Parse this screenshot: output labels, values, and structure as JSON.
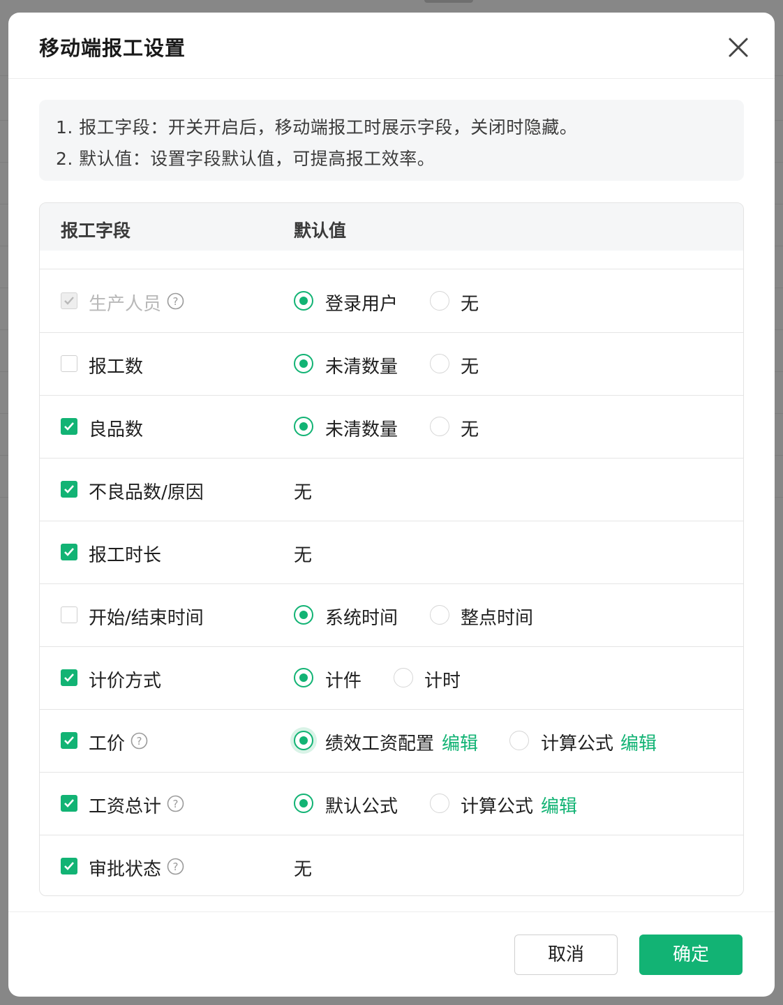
{
  "modal": {
    "title": "移动端报工设置",
    "info_lines": [
      "1. 报工字段：开关开启后，移动端报工时展示字段，关闭时隐藏。",
      "2. 默认值：设置字段默认值，可提高报工效率。"
    ],
    "table": {
      "headers": {
        "field": "报工字段",
        "default": "默认值"
      },
      "rows": [
        {
          "field": "生产人员",
          "checked": true,
          "disabled": true,
          "help": true,
          "options": [
            {
              "label": "登录用户",
              "selected": true
            },
            {
              "label": "无",
              "selected": false
            }
          ]
        },
        {
          "field": "报工数",
          "checked": false,
          "disabled": false,
          "help": false,
          "options": [
            {
              "label": "未清数量",
              "selected": true
            },
            {
              "label": "无",
              "selected": false
            }
          ]
        },
        {
          "field": "良品数",
          "checked": true,
          "disabled": false,
          "help": false,
          "options": [
            {
              "label": "未清数量",
              "selected": true
            },
            {
              "label": "无",
              "selected": false
            }
          ]
        },
        {
          "field": "不良品数/原因",
          "checked": true,
          "disabled": false,
          "help": false,
          "plain": "无"
        },
        {
          "field": "报工时长",
          "checked": true,
          "disabled": false,
          "help": false,
          "plain": "无"
        },
        {
          "field": "开始/结束时间",
          "checked": false,
          "disabled": false,
          "help": false,
          "options": [
            {
              "label": "系统时间",
              "selected": true
            },
            {
              "label": "整点时间",
              "selected": false
            }
          ]
        },
        {
          "field": "计价方式",
          "checked": true,
          "disabled": false,
          "help": false,
          "options": [
            {
              "label": "计件",
              "selected": true
            },
            {
              "label": "计时",
              "selected": false
            }
          ]
        },
        {
          "field": "工价",
          "checked": true,
          "disabled": false,
          "help": true,
          "options": [
            {
              "label": "绩效工资配置",
              "selected": true,
              "link": "编辑"
            },
            {
              "label": "计算公式",
              "selected": false,
              "link": "编辑"
            }
          ]
        },
        {
          "field": "工资总计",
          "checked": true,
          "disabled": false,
          "help": true,
          "options": [
            {
              "label": "默认公式",
              "selected": true
            },
            {
              "label": "计算公式",
              "selected": false,
              "link": "编辑"
            }
          ]
        },
        {
          "field": "审批状态",
          "checked": true,
          "disabled": false,
          "help": true,
          "plain": "无"
        }
      ]
    },
    "footer": {
      "cancel_label": "取消",
      "ok_label": "确定"
    }
  },
  "colors": {
    "accent": "#12b374",
    "border": "#e5e5e5",
    "info_bg": "#f5f6f7"
  },
  "icons": {
    "close": "close-icon",
    "help": "question-circle-icon",
    "check": "check-icon"
  }
}
